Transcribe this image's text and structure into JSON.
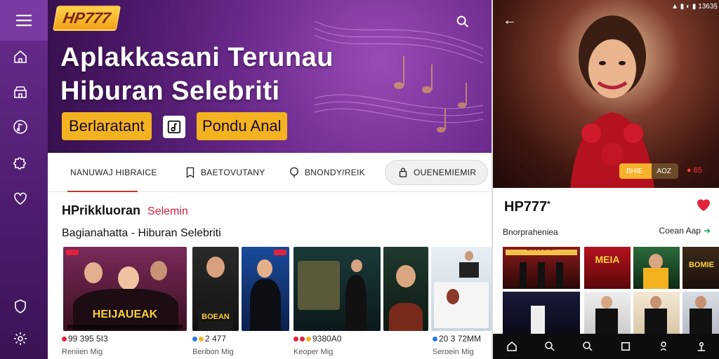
{
  "app": {
    "logo": "HP777"
  },
  "sidebar": {
    "items": [
      {
        "icon": "home-icon"
      },
      {
        "icon": "store-icon"
      },
      {
        "icon": "music-icon"
      },
      {
        "icon": "puzzle-icon"
      },
      {
        "icon": "heart-icon"
      },
      {
        "icon": "shield-icon"
      },
      {
        "icon": "gear-icon"
      }
    ]
  },
  "hero": {
    "title_line1": "Aplakkasani Terunau",
    "title_line2": "Hiburan Selebriti",
    "button1": "Berlaratant",
    "button2": "Pondu Anal"
  },
  "tabs": [
    {
      "label": "NANUWAJ HIBRAICE",
      "icon": ""
    },
    {
      "label": "BAETOVUTANY",
      "icon": "bookmark-icon"
    },
    {
      "label": "BNONDY/REIK",
      "icon": "location-icon"
    },
    {
      "label": "OUENEMIEMIR",
      "icon": "lock-icon"
    }
  ],
  "section": {
    "title": "HPrikkluoran",
    "title_accent": "Selemin",
    "subtitle": "Bagianahatta - Hiburan Selebriti"
  },
  "cards": [
    {
      "label": "HEIJAUEAK",
      "meta": "99 395 5I3",
      "meta2": "Reniien Mig"
    },
    {
      "label": "BOEAN",
      "meta": "2 477",
      "meta2": "Beribon Mig"
    },
    {
      "label": "",
      "meta": "",
      "meta2": ""
    },
    {
      "label": "",
      "meta": "9380A0",
      "meta2": "Keoper Mig"
    },
    {
      "label": "",
      "meta": "20 3 72MM",
      "meta2": "Seroein Mig"
    }
  ],
  "phone": {
    "status": "1363§",
    "title": "HP777",
    "title_mark": "*",
    "sub": "Bnorpraheniea",
    "open_label": "Coean Aap",
    "pill_left": "BHIE",
    "pill_right": "AOZ",
    "pill_far": "65",
    "cards": [
      {
        "label": "LIOOOOAJA"
      },
      {
        "label": "MEIA"
      },
      {
        "label": ""
      },
      {
        "label": "BOMIE"
      }
    ]
  },
  "colors": {
    "sidebar": "#5a2380",
    "accent_gold": "#f3b321",
    "accent_red": "#d21f3c",
    "tab_underline": "#c0392b"
  }
}
